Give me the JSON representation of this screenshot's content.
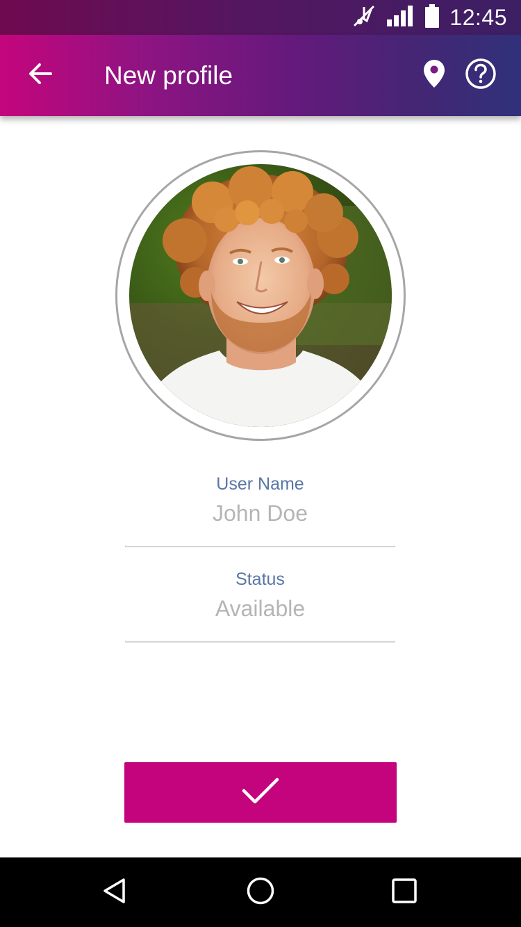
{
  "status_bar": {
    "time": "12:45",
    "icons": [
      "mute-icon",
      "signal-icon",
      "battery-icon"
    ]
  },
  "app_bar": {
    "title": "New profile",
    "back_icon": "arrow-back-icon",
    "actions": [
      "location-pin-icon",
      "help-icon"
    ]
  },
  "profile": {
    "avatar": "profile-photo",
    "fields": [
      {
        "label": "User Name",
        "value": "John Doe"
      },
      {
        "label": "Status",
        "value": "Available"
      }
    ]
  },
  "confirm_button": {
    "icon": "checkmark-icon"
  },
  "nav_bar": {
    "buttons": [
      "back-triangle-icon",
      "home-circle-icon",
      "recents-square-icon"
    ]
  },
  "colors": {
    "accent": "#c4047c",
    "app_bar_start": "#c4057c",
    "app_bar_end": "#30317a",
    "label": "#5a76a6",
    "input_text": "#b5b5b5"
  }
}
